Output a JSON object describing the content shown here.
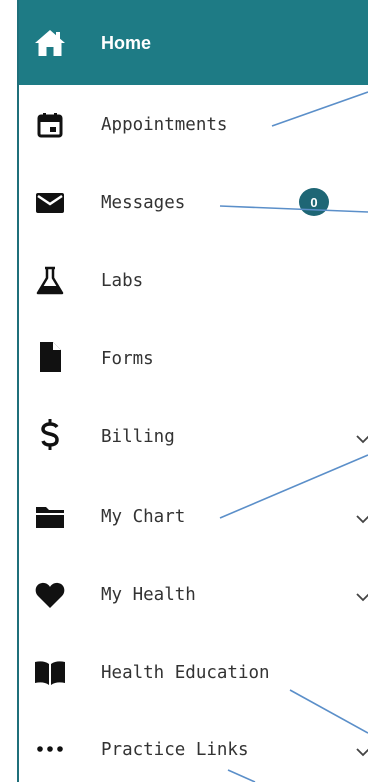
{
  "nav": {
    "items": [
      {
        "label": "Home",
        "icon": "home-icon",
        "active": true
      },
      {
        "label": "Appointments",
        "icon": "calendar-icon"
      },
      {
        "label": "Messages",
        "icon": "envelope-icon",
        "badge": "0"
      },
      {
        "label": "Labs",
        "icon": "flask-icon"
      },
      {
        "label": "Forms",
        "icon": "document-icon"
      },
      {
        "label": "Billing",
        "icon": "dollar-icon",
        "expandable": true
      },
      {
        "label": "My Chart",
        "icon": "folder-icon",
        "expandable": true
      },
      {
        "label": "My Health",
        "icon": "heart-icon",
        "expandable": true
      },
      {
        "label": "Health Education",
        "icon": "book-icon"
      },
      {
        "label": "Practice Links",
        "icon": "ellipsis-icon",
        "expandable": true
      }
    ]
  },
  "colors": {
    "active_bg": "#1e7b85",
    "badge_bg": "#1e6675",
    "callout_line": "#5b8fc9"
  }
}
